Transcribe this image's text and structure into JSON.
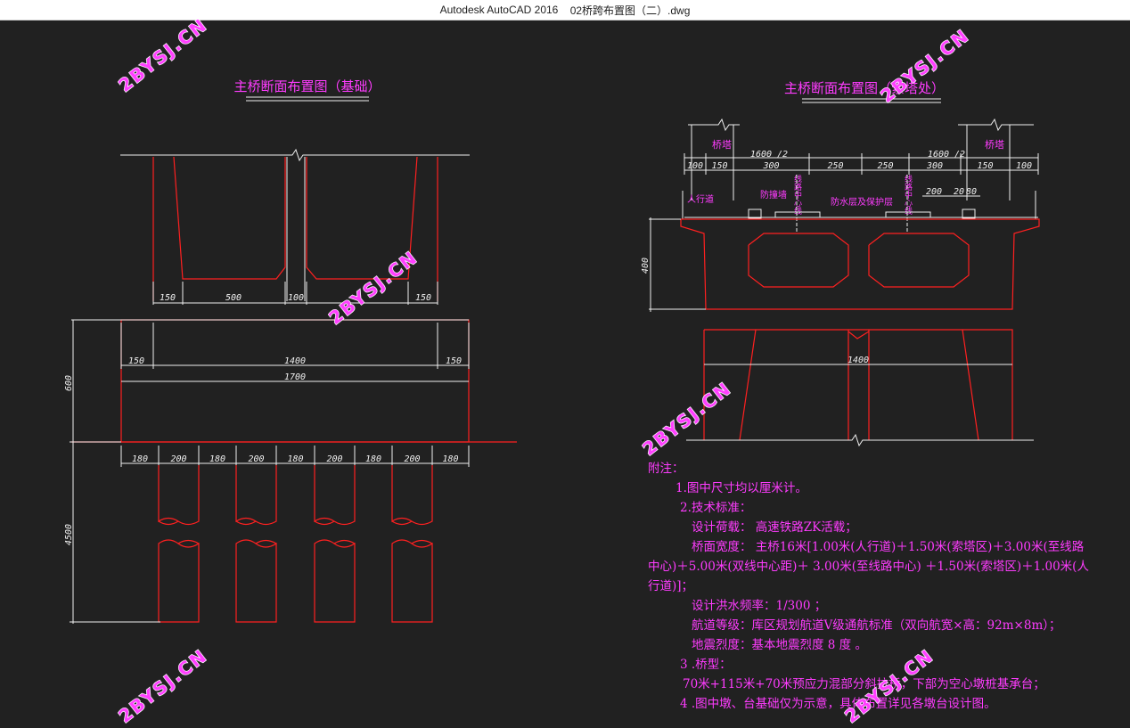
{
  "window": {
    "app_title": "Autodesk AutoCAD 2016",
    "file_name": "02桥跨布置图（二）.dwg"
  },
  "watermark": "2BYSJ.CN",
  "left_drawing": {
    "title": "主桥断面布置图（基础）",
    "dims_top": [
      "150",
      "500",
      "100",
      "150"
    ],
    "dims_mid": [
      "150",
      "1400",
      "150"
    ],
    "dim_total": "1700",
    "dim_height_cap": "600",
    "dim_height_pile": "4500",
    "pile_spacing": [
      "180",
      "200",
      "180",
      "200",
      "180",
      "200",
      "180",
      "200",
      "180"
    ]
  },
  "right_drawing": {
    "title": "主桥断面布置图（索塔处）",
    "tower_label": "桥塔",
    "half_width": "1600 /2",
    "dims_row": [
      "100",
      "150",
      "300",
      "250",
      "250",
      "300",
      "150",
      "100"
    ],
    "dims_small": [
      "200",
      "20",
      "80"
    ],
    "labels": {
      "sidewalk": "人行道",
      "barrier": "防撞墙",
      "waterproof": "防水层及保护层",
      "line_center": "线路中心线"
    },
    "height": "400",
    "bottom_width": "1400"
  },
  "notes": {
    "heading": "附注：",
    "lines": [
      "1.图中尺寸均以厘米计。",
      "2.技术标准：",
      "设计荷载： 高速铁路ZK活载；",
      "桥面宽度： 主桥16米[1.00米(人行道)＋1.50米(索塔区)＋3.00米(至线路",
      "中心)＋5.00米(双线中心距)＋ 3.00米(至线路中心) ＋1.50米(索塔区)＋1.00米(人",
      "行道)]；",
      "设计洪水频率：1/300 ；",
      "航道等级：库区规划航道Ⅴ级通航标准（双向航宽×高：92m×8m）；",
      "地震烈度：基本地震烈度 8 度 。",
      "3 .桥型：",
      "70米+115米+70米预应力混部分斜拉桥，下部为空心墩桩基承台；",
      "4 .图中墩、台基础仅为示意，具体布置详见各墩台设计图。"
    ]
  }
}
